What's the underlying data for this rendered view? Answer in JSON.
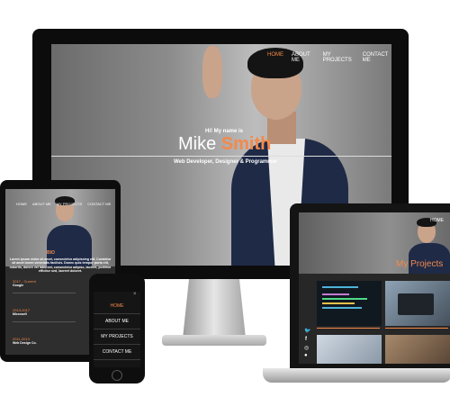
{
  "monitor": {
    "nav": [
      "HOME",
      "ABOUT ME",
      "MY PROJECTS",
      "CONTACT ME"
    ],
    "hi": "Hi! My name is",
    "first_name": "Mike",
    "last_name": "Smith",
    "subtitle": "Web Developer, Designer & Programmer"
  },
  "tablet": {
    "nav": [
      "HOME",
      "ABOUT ME",
      "MY PROJECTS",
      "CONTACT ME"
    ],
    "section": "BIO",
    "bio": "Lorem ipsum dolor sit amet, consectetur adipiscing elit. Curabitur sit amet lorem venenatis facilisis. Donec quis tempor porta elit, lobortis, dolore vel laboreet, consectetur adipisc, laoreet, porttitor efficitur sed, laoreet doloret.",
    "timeline": [
      {
        "years": "2017 - Current",
        "company": "Google"
      },
      {
        "years": "2013-2017",
        "company": "Microsoft"
      },
      {
        "years": "2011-2013",
        "company": "Web Design Co."
      }
    ]
  },
  "phone": {
    "menu": [
      "HOME",
      "ABOUT ME",
      "MY PROJECTS",
      "CONTACT ME"
    ],
    "close": "×"
  },
  "laptop": {
    "nav_home": "HOME",
    "heading": "My Projects",
    "social": [
      "twitter-icon",
      "facebook-icon",
      "instagram-icon",
      "github-icon"
    ]
  },
  "colors": {
    "accent": "#f4894a",
    "dark": "#0c0c0c"
  }
}
